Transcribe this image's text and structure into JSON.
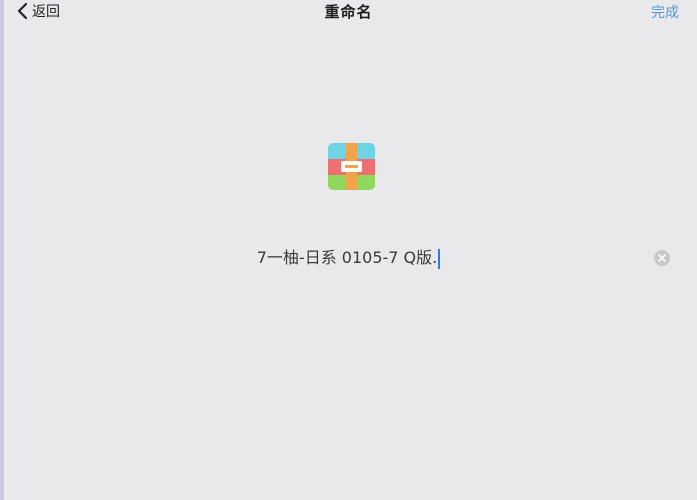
{
  "nav": {
    "back_label": "返回",
    "title": "重命名",
    "done_label": "完成"
  },
  "file": {
    "icon": "archive-icon",
    "name": "7一柚-日系 0105-7 Q版."
  },
  "colors": {
    "accent": "#4f9bd8",
    "caret": "#2d7be0",
    "background": "#e9e9eb"
  }
}
